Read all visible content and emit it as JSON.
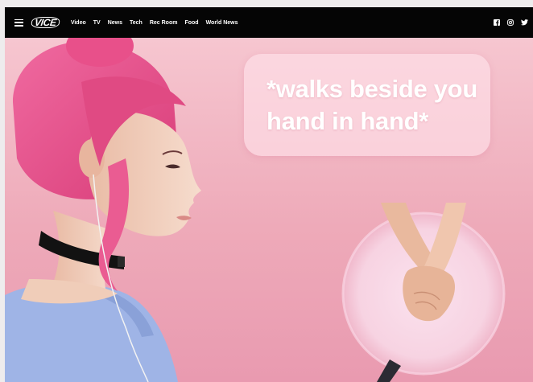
{
  "header": {
    "logo_text": "VICE",
    "nav": [
      {
        "label": "Video"
      },
      {
        "label": "TV"
      },
      {
        "label": "News"
      },
      {
        "label": "Tech"
      },
      {
        "label": "Rec Room"
      },
      {
        "label": "Food"
      },
      {
        "label": "World News"
      }
    ],
    "social_icons": [
      "facebook-icon",
      "instagram-icon",
      "twitter-icon"
    ]
  },
  "hero": {
    "speech_bubble": {
      "line1": "*walks beside you",
      "line2": "hand in hand*"
    },
    "colors": {
      "background": "#eeaab9",
      "hair": "#e8508a",
      "skin": "#f3d2c0",
      "shirt": "#9fb4e6",
      "choker": "#111111"
    }
  }
}
